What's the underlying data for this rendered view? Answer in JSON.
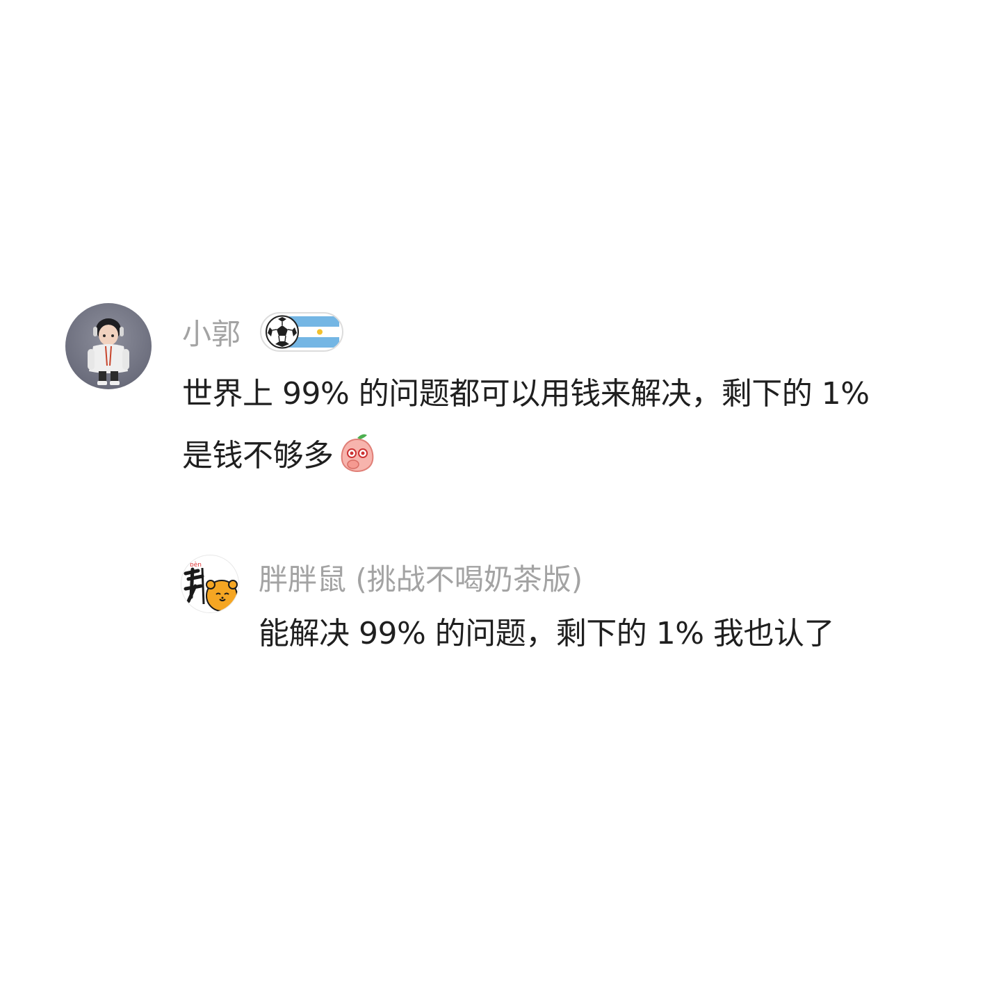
{
  "comments": [
    {
      "username": "小郭",
      "badge_icon": "football-argentina-badge-icon",
      "text_line_1": "世界上 99% 的问题都可以用钱来解决，剩下的 1%",
      "text_line_2": "是钱不够多",
      "emoji": "peach-shy-emoji-icon"
    },
    {
      "username": "胖胖鼠 (挑战不喝奶茶版)",
      "text_line_1": "能解决 99% 的问题，剩下的 1% 我也认了"
    }
  ],
  "colors": {
    "username": "#a3a3a3",
    "text": "#1f1f1f",
    "background": "#ffffff"
  }
}
